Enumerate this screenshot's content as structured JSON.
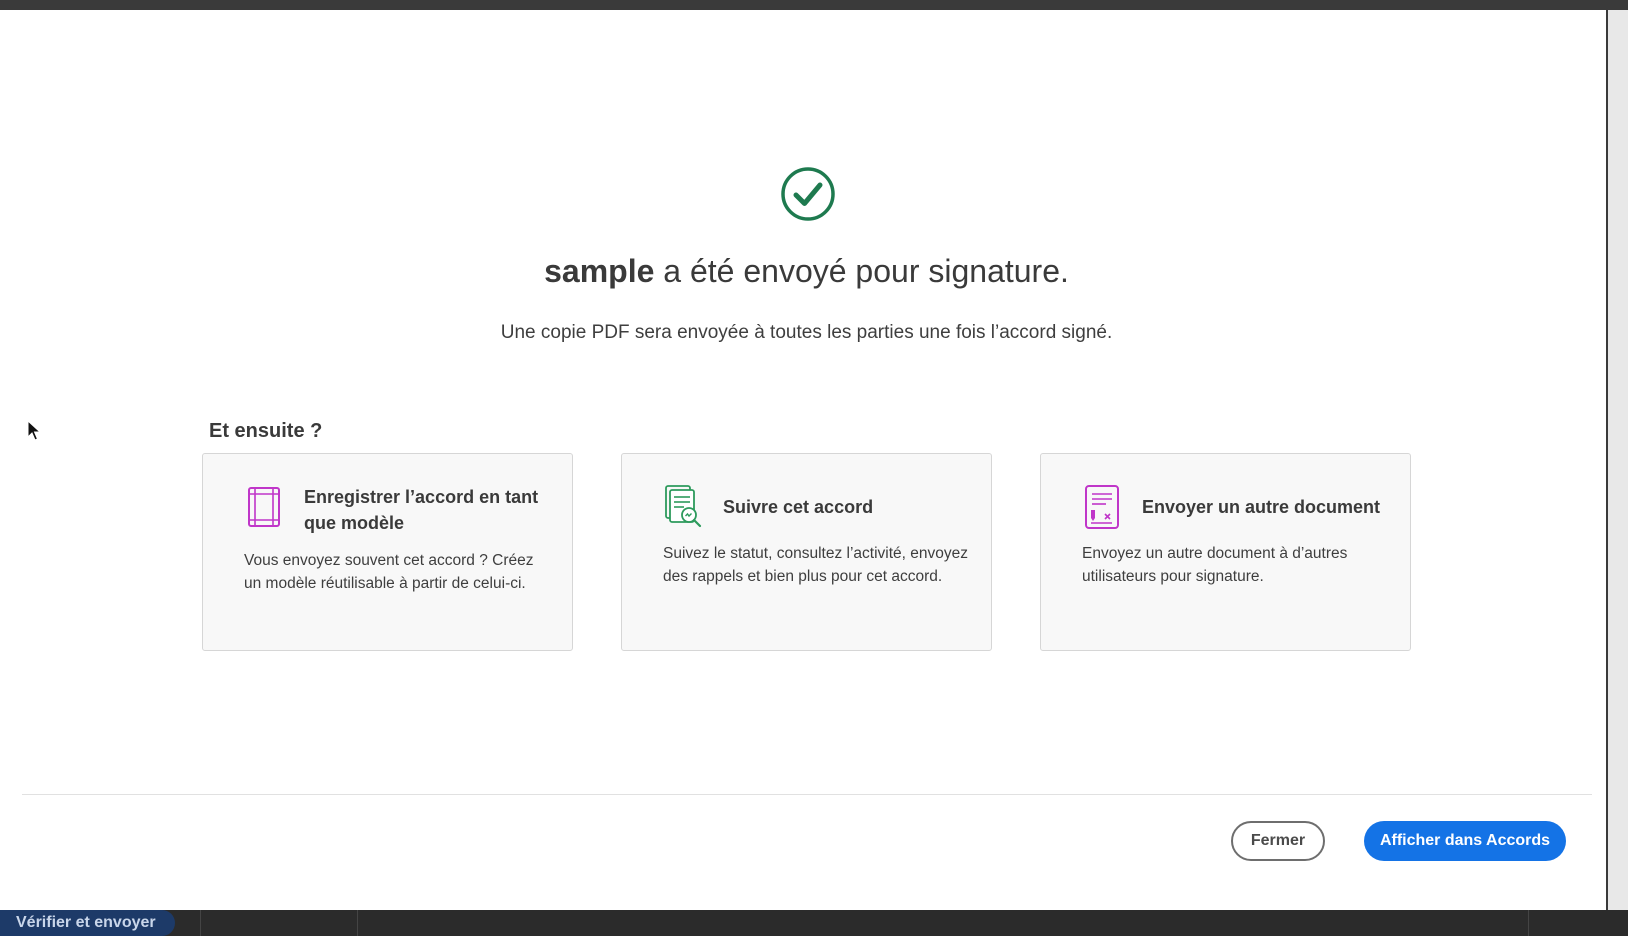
{
  "background": {
    "footer_button_label": "Vérifier et envoyer"
  },
  "modal": {
    "headline_bold": "sample",
    "headline_rest": " a été envoyé pour signature.",
    "subtitle": "Une copie PDF sera envoyée à toutes les parties une fois l’accord signé.",
    "section_title": "Et ensuite ?",
    "cards": [
      {
        "icon": "template-icon",
        "title": "Enregistrer l’accord en tant que modèle",
        "description": "Vous envoyez souvent cet accord ? Créez un modèle réutilisable à partir de celui-ci."
      },
      {
        "icon": "track-agreement-icon",
        "title": "Suivre cet accord",
        "description": "Suivez le statut, consultez l’activité, envoyez des rappels et bien plus pour cet accord."
      },
      {
        "icon": "send-document-icon",
        "title": "Envoyer un autre document",
        "description": "Envoyez un autre document à d’autres utilisateurs pour signature."
      }
    ],
    "close_label": "Fermer",
    "primary_label": "Afficher dans Accords"
  },
  "colors": {
    "success_green": "#1e7a4f",
    "primary_blue": "#1473e6",
    "icon_magenta": "#c036c9"
  }
}
